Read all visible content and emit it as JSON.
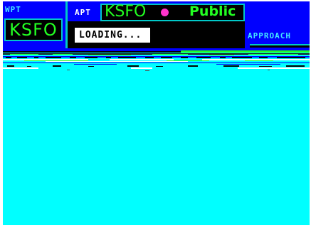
{
  "left_panel": {
    "page_tag": "WPT",
    "identifier": "KSFO"
  },
  "center_panel": {
    "page_tag": "APT",
    "identifier": "KSFO",
    "usage": "Public",
    "status": "LOADING..."
  },
  "right_panel": {
    "label": "APPROACH"
  },
  "colors": {
    "screen": "#00ffff",
    "frame": "#0000ff",
    "field_text": "#22ff22",
    "usage_dot": "#ff33cc"
  }
}
